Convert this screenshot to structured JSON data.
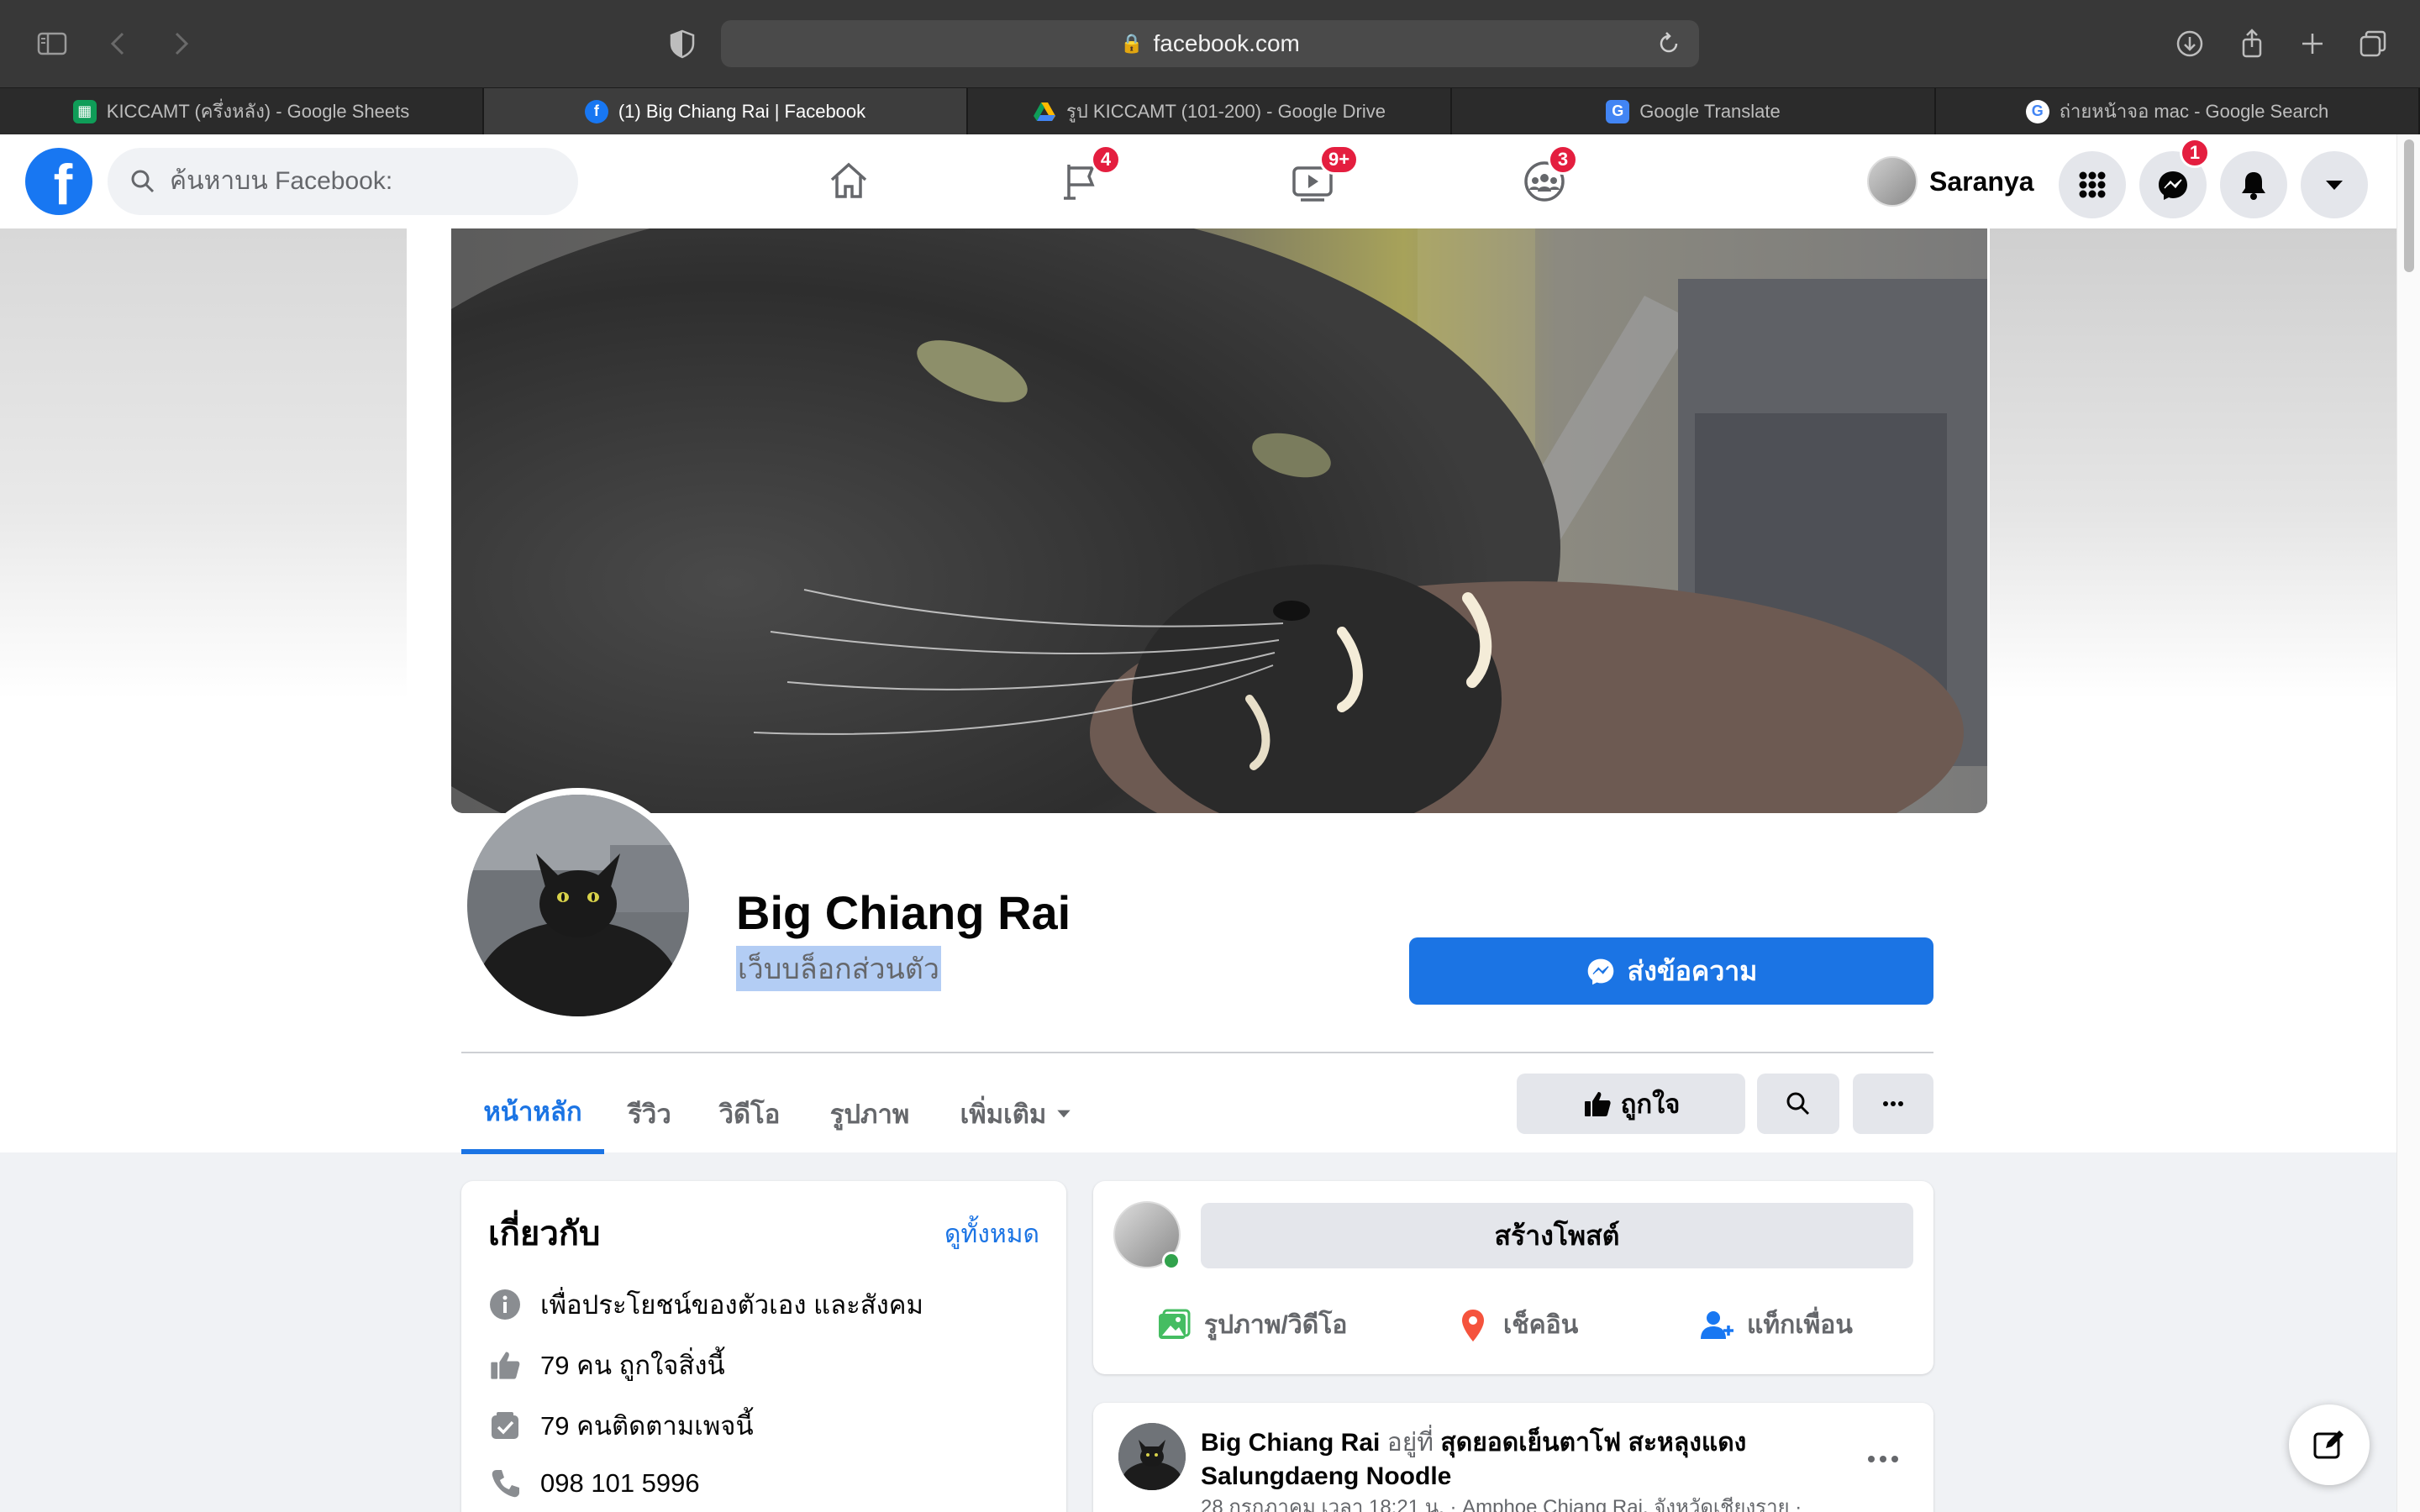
{
  "browser": {
    "url": "facebook.com",
    "tabs": [
      {
        "label": "KICCAMT (ครึ่งหลัง) - Google Sheets",
        "icon": "google-sheets-icon",
        "active": false
      },
      {
        "label": "(1) Big Chiang Rai | Facebook",
        "icon": "facebook-icon",
        "active": true
      },
      {
        "label": "รูป KICCAMT (101-200) - Google Drive",
        "icon": "google-drive-icon",
        "active": false
      },
      {
        "label": "Google Translate",
        "icon": "google-translate-icon",
        "active": false
      },
      {
        "label": "ถ่ายหน้าจอ mac - Google Search",
        "icon": "google-icon",
        "active": false
      }
    ]
  },
  "fb_nav": {
    "search_placeholder": "ค้นหาบน Facebook:",
    "badges": {
      "pages": "4",
      "watch": "9+",
      "groups": "3",
      "messenger": "1"
    },
    "user_name": "Saranya"
  },
  "page": {
    "name": "Big Chiang Rai",
    "category": "เว็บบล็อกส่วนตัว",
    "send_message": "ส่งข้อความ",
    "tabs": [
      "หน้าหลัก",
      "รีวิว",
      "วิดีโอ",
      "รูปภาพ",
      "เพิ่มเติม"
    ],
    "like_button": "ถูกใจ"
  },
  "about": {
    "title": "เกี่ยวกับ",
    "see_all": "ดูทั้งหมด",
    "rows": [
      {
        "icon": "info-icon",
        "text": "เพื่อประโยชน์ของตัวเอง และสังคม"
      },
      {
        "icon": "thumbs-up-icon",
        "text": "79 คน ถูกใจสิ่งนี้"
      },
      {
        "icon": "follow-check-icon",
        "text": "79 คนติดตามเพจนี้"
      },
      {
        "icon": "phone-icon",
        "text": "098 101 5996"
      }
    ]
  },
  "composer": {
    "create_post": "สร้างโพสต์",
    "actions": [
      {
        "icon": "photo-video-icon",
        "label": "รูปภาพ/วิดีโอ",
        "color": "#45bd62"
      },
      {
        "icon": "check-in-icon",
        "label": "เช็คอิน",
        "color": "#f5533d"
      },
      {
        "icon": "tag-friends-icon",
        "label": "แท็กเพื่อน",
        "color": "#1877f2"
      }
    ]
  },
  "post": {
    "author": "Big Chiang Rai",
    "at_word": "อยู่ที่",
    "place": "สุดยอดเย็นตาโฟ สะหลุงแดง Salungdaeng Noodle",
    "meta": "28 กรกฎาคม เวลา 18:21 น. · Amphoe Chiang Rai, จังหวัดเชียงราย ·"
  },
  "colors": {
    "facebook_blue": "#1877f2",
    "badge_red": "#e41e3f",
    "link_blue": "#1b74e4"
  }
}
